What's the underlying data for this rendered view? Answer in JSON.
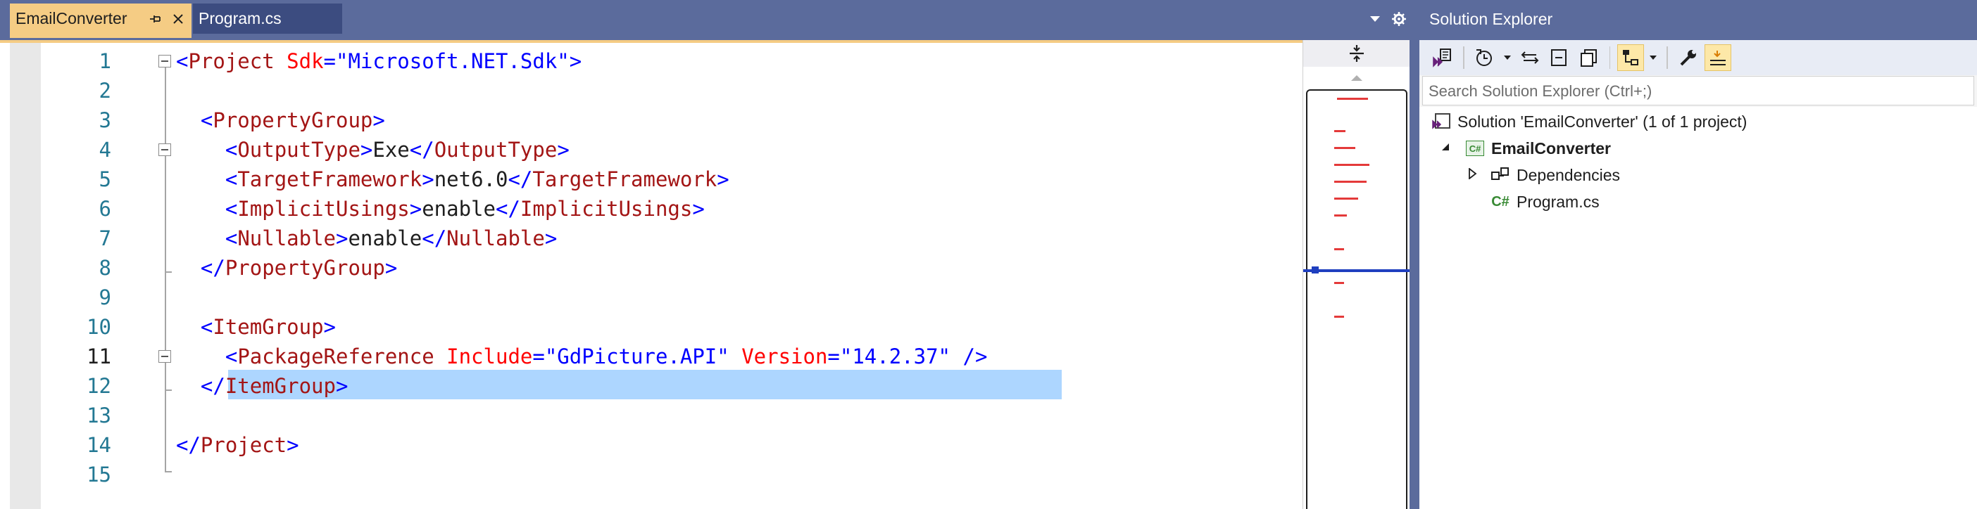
{
  "editor_tabs": [
    {
      "label": "EmailConverter",
      "active": true
    },
    {
      "label": "Program.cs",
      "active": false
    }
  ],
  "line_numbers": [
    "1",
    "2",
    "3",
    "4",
    "5",
    "6",
    "7",
    "8",
    "9",
    "10",
    "11",
    "12",
    "13",
    "14",
    "15"
  ],
  "current_line": 11,
  "code_lines": [
    [
      {
        "t": "<",
        "c": "delim"
      },
      {
        "t": "Project",
        "c": "elem"
      },
      {
        "t": " ",
        "c": "txt"
      },
      {
        "t": "Sdk",
        "c": "attr"
      },
      {
        "t": "=\"Microsoft.NET.Sdk\"",
        "c": "val"
      },
      {
        "t": ">",
        "c": "delim"
      }
    ],
    [],
    [
      {
        "t": "  ",
        "c": "txt"
      },
      {
        "t": "<",
        "c": "delim"
      },
      {
        "t": "PropertyGroup",
        "c": "elem"
      },
      {
        "t": ">",
        "c": "delim"
      }
    ],
    [
      {
        "t": "    ",
        "c": "txt"
      },
      {
        "t": "<",
        "c": "delim"
      },
      {
        "t": "OutputType",
        "c": "elem"
      },
      {
        "t": ">",
        "c": "delim"
      },
      {
        "t": "Exe",
        "c": "txt"
      },
      {
        "t": "</",
        "c": "delim"
      },
      {
        "t": "OutputType",
        "c": "elem"
      },
      {
        "t": ">",
        "c": "delim"
      }
    ],
    [
      {
        "t": "    ",
        "c": "txt"
      },
      {
        "t": "<",
        "c": "delim"
      },
      {
        "t": "TargetFramework",
        "c": "elem"
      },
      {
        "t": ">",
        "c": "delim"
      },
      {
        "t": "net6.0",
        "c": "txt"
      },
      {
        "t": "</",
        "c": "delim"
      },
      {
        "t": "TargetFramework",
        "c": "elem"
      },
      {
        "t": ">",
        "c": "delim"
      }
    ],
    [
      {
        "t": "    ",
        "c": "txt"
      },
      {
        "t": "<",
        "c": "delim"
      },
      {
        "t": "ImplicitUsings",
        "c": "elem"
      },
      {
        "t": ">",
        "c": "delim"
      },
      {
        "t": "enable",
        "c": "txt"
      },
      {
        "t": "</",
        "c": "delim"
      },
      {
        "t": "ImplicitUsings",
        "c": "elem"
      },
      {
        "t": ">",
        "c": "delim"
      }
    ],
    [
      {
        "t": "    ",
        "c": "txt"
      },
      {
        "t": "<",
        "c": "delim"
      },
      {
        "t": "Nullable",
        "c": "elem"
      },
      {
        "t": ">",
        "c": "delim"
      },
      {
        "t": "enable",
        "c": "txt"
      },
      {
        "t": "</",
        "c": "delim"
      },
      {
        "t": "Nullable",
        "c": "elem"
      },
      {
        "t": ">",
        "c": "delim"
      }
    ],
    [
      {
        "t": "  ",
        "c": "txt"
      },
      {
        "t": "</",
        "c": "delim"
      },
      {
        "t": "PropertyGroup",
        "c": "elem"
      },
      {
        "t": ">",
        "c": "delim"
      }
    ],
    [],
    [
      {
        "t": "  ",
        "c": "txt"
      },
      {
        "t": "<",
        "c": "delim"
      },
      {
        "t": "ItemGroup",
        "c": "elem"
      },
      {
        "t": ">",
        "c": "delim"
      }
    ],
    [
      {
        "t": "    ",
        "c": "txt"
      },
      {
        "t": "<",
        "c": "delim"
      },
      {
        "t": "PackageReference",
        "c": "elem"
      },
      {
        "t": " ",
        "c": "txt"
      },
      {
        "t": "Include",
        "c": "attr"
      },
      {
        "t": "=\"GdPicture.API\"",
        "c": "val"
      },
      {
        "t": " ",
        "c": "txt"
      },
      {
        "t": "Version",
        "c": "attr"
      },
      {
        "t": "=\"14.2.37\"",
        "c": "val"
      },
      {
        "t": " ",
        "c": "txt"
      },
      {
        "t": "/>",
        "c": "delim"
      }
    ],
    [
      {
        "t": "  ",
        "c": "txt"
      },
      {
        "t": "</",
        "c": "delim"
      },
      {
        "t": "ItemGroup",
        "c": "elem"
      },
      {
        "t": ">",
        "c": "delim"
      }
    ],
    [],
    [
      {
        "t": "</",
        "c": "delim"
      },
      {
        "t": "Project",
        "c": "elem"
      },
      {
        "t": ">",
        "c": "delim"
      }
    ],
    []
  ],
  "solution_explorer": {
    "title": "Solution Explorer",
    "search_placeholder": "Search Solution Explorer (Ctrl+;)",
    "tree": [
      {
        "label": "Solution 'EmailConverter' (1 of 1 project)",
        "icon": "solution-icon"
      },
      {
        "label": "EmailConverter",
        "icon": "csharp-project-icon"
      },
      {
        "label": "Dependencies",
        "icon": "dependencies-icon"
      },
      {
        "label": "Program.cs",
        "icon": "csharp-file-icon"
      }
    ]
  },
  "colors": {
    "tab_strip": "#5b6b9c",
    "active_tab": "#f5cc84",
    "xml_delimiter": "#0000ff",
    "xml_element": "#a31515",
    "xml_attribute": "#ff0000",
    "line_number": "#237893",
    "selection": "#add6ff"
  }
}
